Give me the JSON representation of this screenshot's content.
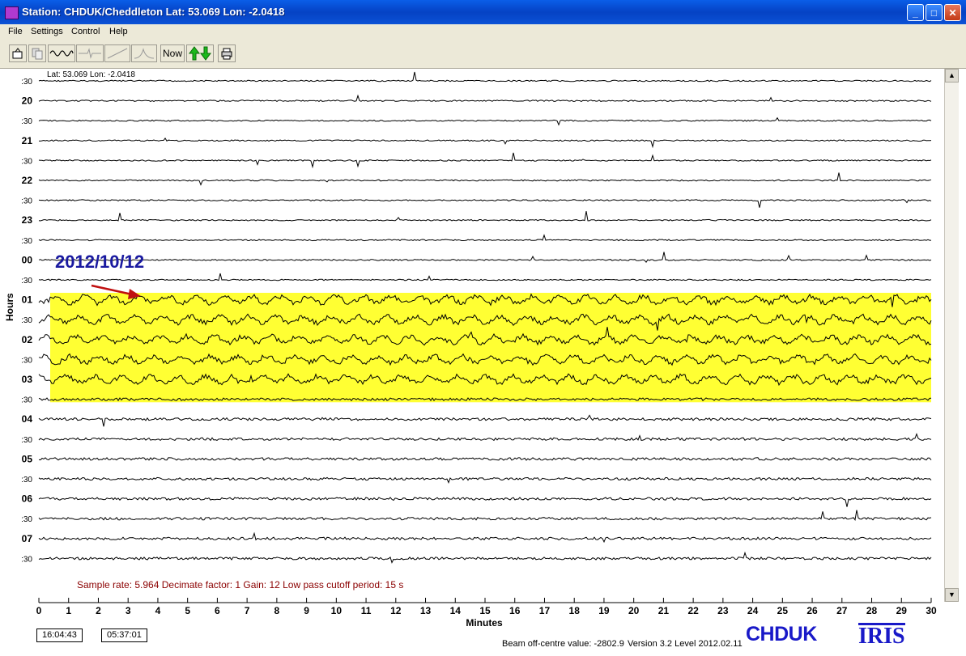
{
  "window": {
    "title": "Station: CHDUK/Cheddleton Lat: 53.069 Lon: -2.0418",
    "minimize": "_",
    "maximize": "□",
    "close": "✕"
  },
  "menu": [
    "File",
    "Settings",
    "Control",
    "Help"
  ],
  "toolbar": {
    "now_label": "Now",
    "icons": [
      "open-file-icon",
      "copy-icon",
      "wave-icon",
      "event-icon",
      "filter-icon",
      "spectrum-icon",
      "up-down-arrows-icon",
      "print-icon"
    ]
  },
  "helicorder": {
    "station_coords": "Lat: 53.069 Lon: -2.0418",
    "hour_labels": [
      ":30",
      "20",
      ":30",
      "21",
      ":30",
      "22",
      ":30",
      "23",
      ":30",
      "00",
      ":30",
      "01",
      ":30",
      "02",
      ":30",
      "03",
      ":30",
      "04",
      ":30",
      "05",
      ":30",
      "06",
      ":30",
      "07",
      ":30"
    ],
    "y_axis_label": "Hours",
    "x_axis_label": "Minutes",
    "x_ticks": [
      "0",
      "1",
      "2",
      "3",
      "4",
      "5",
      "6",
      "7",
      "8",
      "9",
      "10",
      "11",
      "12",
      "13",
      "14",
      "15",
      "16",
      "17",
      "18",
      "19",
      "20",
      "21",
      "22",
      "23",
      "24",
      "25",
      "26",
      "27",
      "28",
      "29",
      "30"
    ],
    "date_annotation": "2012/10/12",
    "highlight_color": "#ffff33",
    "annotation_color": "#1a1aa0",
    "arrow_color": "#c01010",
    "info_line": "Sample rate: 5.964  Decimate factor: 1  Gain: 12  Low pass cutoff period: 15 s",
    "info_color": "#8b0000"
  },
  "status": {
    "time_utc": "16:04:43",
    "time_elapsed": "05:37:01",
    "beam_offset": "Beam off-centre value: -2802.9",
    "version": "Version 3.2 Level 2012.02.11"
  },
  "logos": {
    "chduk": "CHDUK",
    "iris": "IRIS"
  }
}
